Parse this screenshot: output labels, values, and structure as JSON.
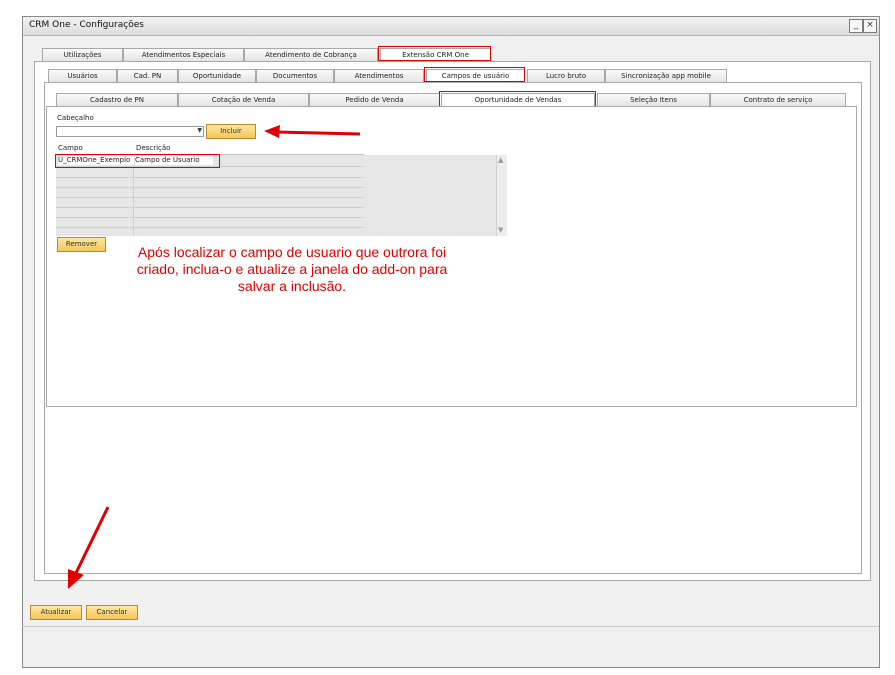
{
  "window": {
    "title": "CRM One - Configurações",
    "minimize_glyph": "_",
    "close_glyph": "×"
  },
  "tabs_level1": [
    "Utilizações",
    "Atendimentos Especiais",
    "Atendimento de Cobrança",
    "Extensão CRM One"
  ],
  "tabs_level2": [
    "Usuários",
    "Cad. PN",
    "Oportunidade",
    "Documentos",
    "Atendimentos",
    "Campos de usuário",
    "Lucro bruto",
    "Sincronização app mobile"
  ],
  "tabs_level3": [
    "Cadastro de PN",
    "Cotação de Venda",
    "Pedido de Venda",
    "Oportunidade de Vendas",
    "Seleção Itens",
    "Contrato de serviço"
  ],
  "form": {
    "header_label": "Cabeçalho",
    "combo_value": "",
    "include_label": "Incluir",
    "remove_label": "Remover"
  },
  "grid": {
    "columns": [
      "Campo",
      "Descrição"
    ],
    "rows": [
      [
        "U_CRMOne_Exemplo",
        "Campo de Usuario"
      ]
    ]
  },
  "annotation": "Após localizar o campo de usuario que outrora foi criado, inclua-o e atualize a janela do add-on para salvar a inclusão.",
  "footer": {
    "update_label": "Atualizar",
    "cancel_label": "Cancelar"
  },
  "colors": {
    "highlight": "#e00000",
    "button": "#f4c65a"
  }
}
